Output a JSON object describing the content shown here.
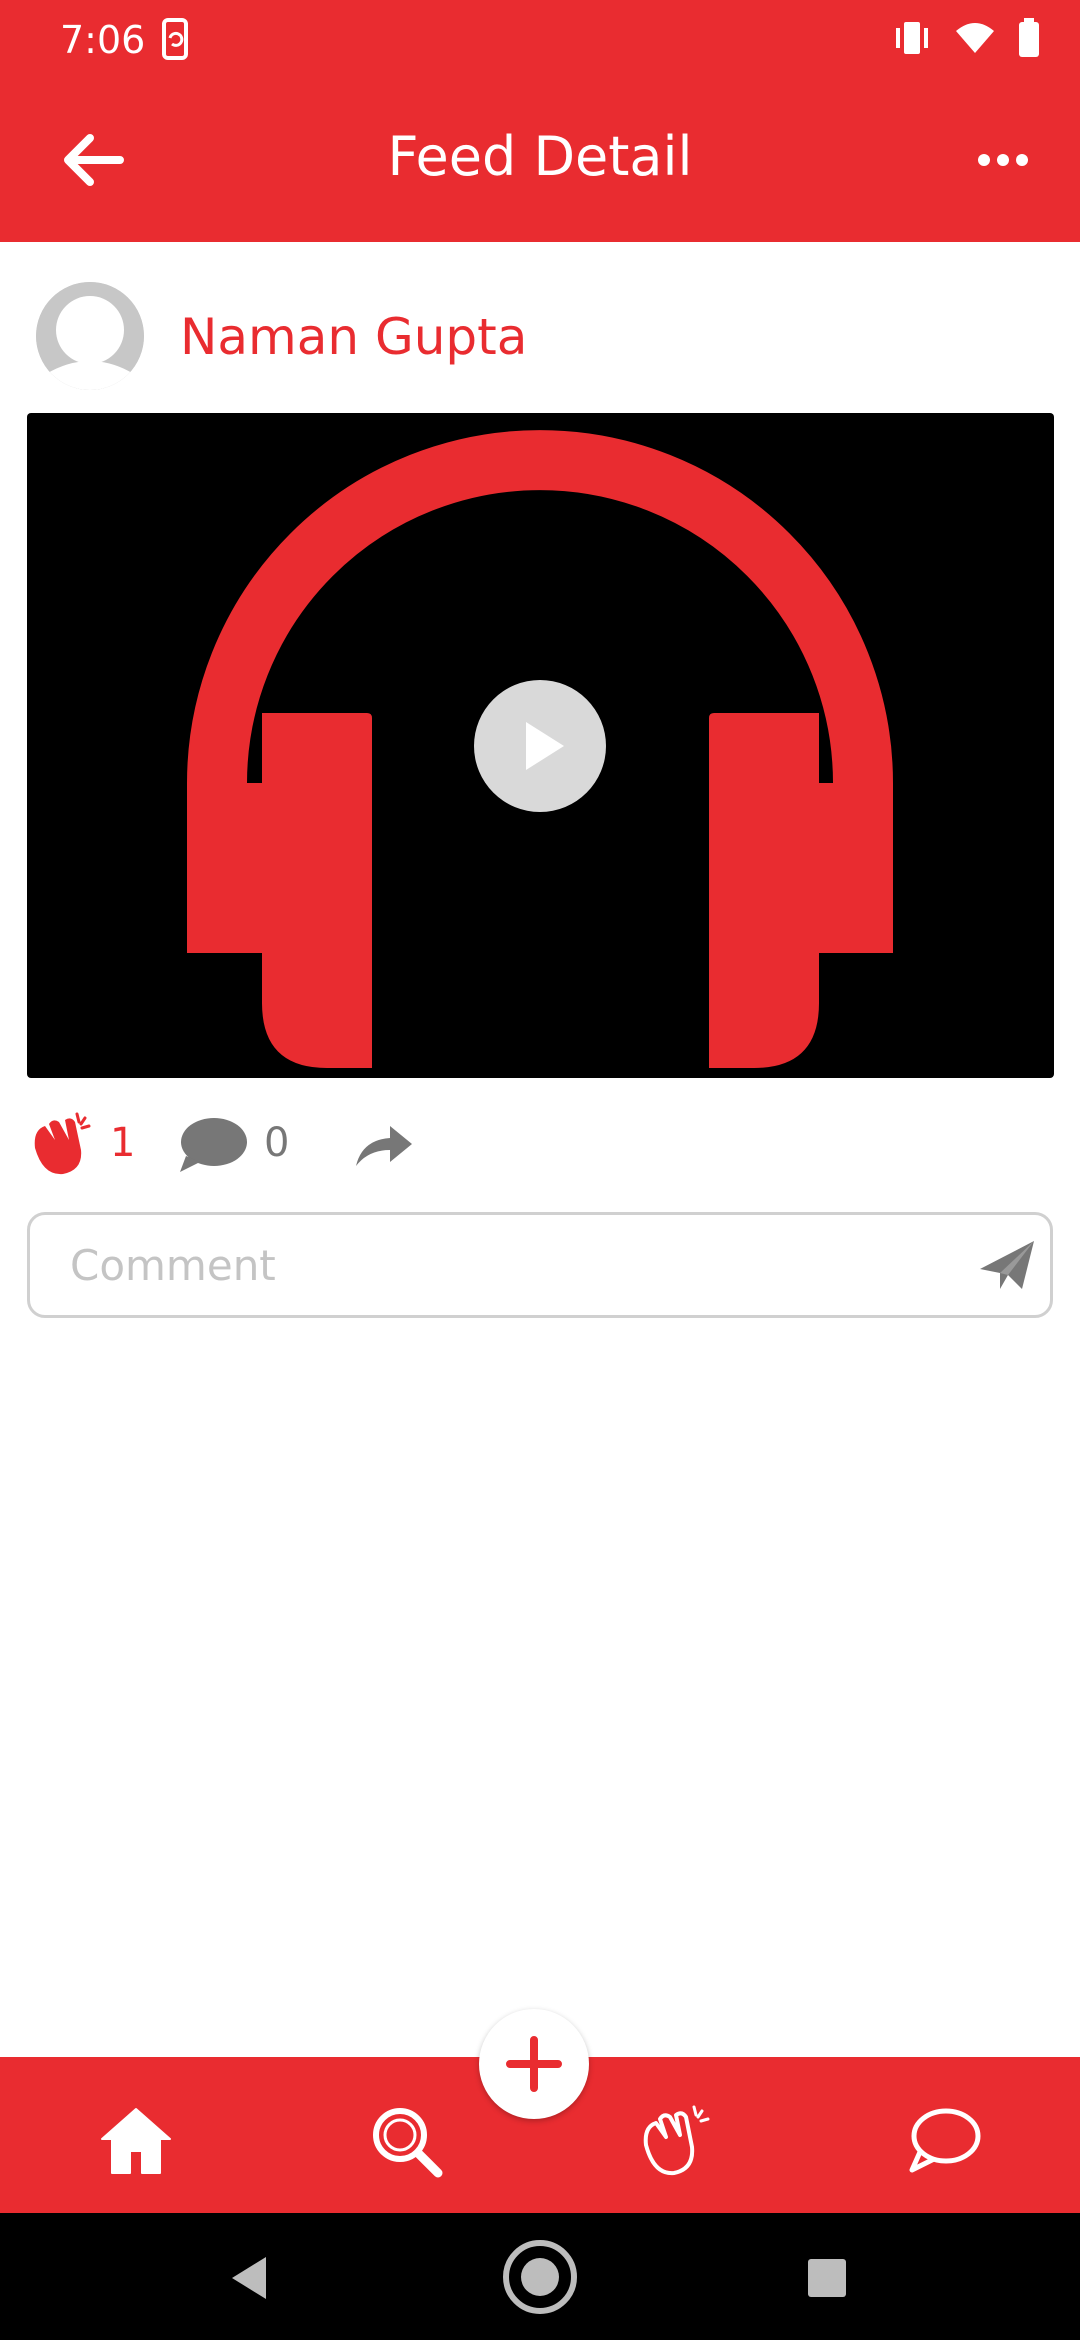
{
  "status_bar": {
    "time": "7:06",
    "icons": [
      "screen-rotate-icon",
      "vibrate-icon",
      "wifi-icon",
      "battery-icon"
    ]
  },
  "app_bar": {
    "title": "Feed Detail",
    "back_icon": "arrow-left-icon",
    "more_icon": "more-horizontal-icon"
  },
  "post": {
    "author_name": "Naman Gupta",
    "media_icon": "headphones-icon",
    "play_icon": "play-icon",
    "clap_count": "1",
    "comment_count": "0",
    "share_icon": "share-icon"
  },
  "comment_box": {
    "placeholder": "Comment",
    "value": "",
    "send_icon": "send-icon"
  },
  "bottom_nav": {
    "items": [
      "home-icon",
      "search-icon",
      "clap-icon",
      "chat-icon"
    ],
    "fab_icon": "plus-icon"
  },
  "system_nav": [
    "back-triangle-icon",
    "home-circle-icon",
    "recents-square-icon"
  ],
  "colors": {
    "accent": "#e92c30",
    "muted_icon": "#777777",
    "placeholder": "#c4c4c4"
  }
}
